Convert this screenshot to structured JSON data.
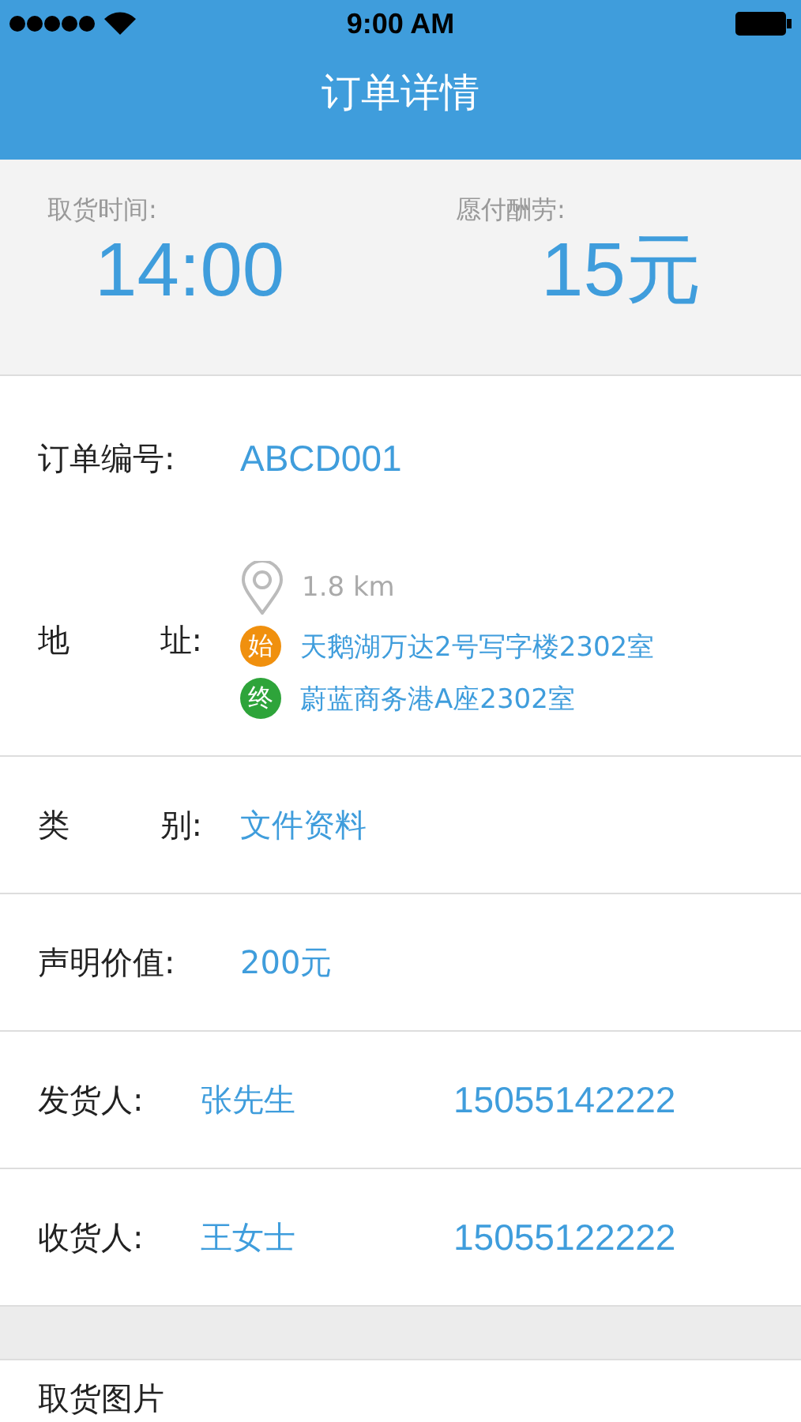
{
  "status_bar": {
    "time": "9:00 AM"
  },
  "nav": {
    "title": "订单详情"
  },
  "summary": [
    {
      "label": "取货时间:",
      "value": "14:00"
    },
    {
      "label": "愿付酬劳:",
      "value": "15元"
    }
  ],
  "order": {
    "label": "订单编号:",
    "value": "ABCD001"
  },
  "address": {
    "label_start": "地",
    "label_end": "址:",
    "distance": "1.8 km",
    "stops": [
      {
        "badge": "始",
        "color": "#f0900e",
        "text": "天鹅湖万达2号写字楼2302室"
      },
      {
        "badge": "终",
        "color": "#2ea43a",
        "text": "蔚蓝商务港A座2302室"
      }
    ]
  },
  "fields": [
    {
      "kind": "spaced",
      "label_start": "类",
      "label_end": "别:",
      "value": "文件资料"
    },
    {
      "kind": "plain",
      "label": "声明价值:",
      "value": "200元"
    },
    {
      "kind": "contact",
      "label": "发货人:",
      "value": "张先生",
      "phone": "15055142222"
    },
    {
      "kind": "contact",
      "label": "收货人:",
      "value": "王女士",
      "phone": "15055122222"
    }
  ],
  "photos": {
    "label": "取货图片"
  }
}
